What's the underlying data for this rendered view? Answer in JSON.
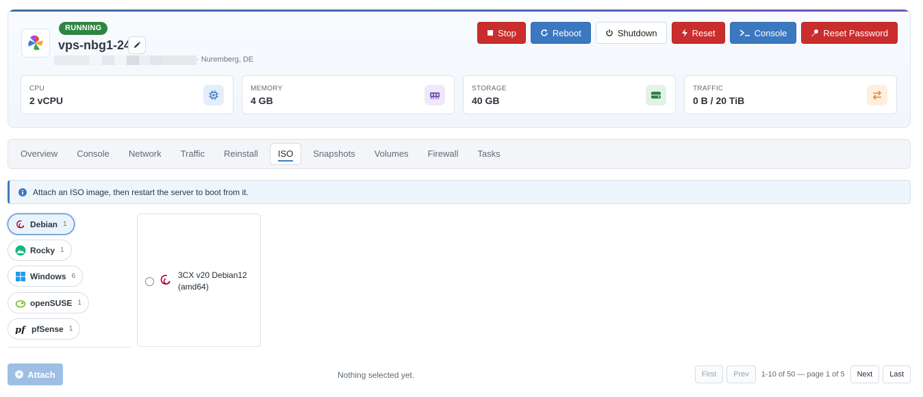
{
  "server": {
    "status": "RUNNING",
    "name": "vps-nbg1-24",
    "location": "· Nuremberg, DE",
    "status_color": "#2e8540"
  },
  "actions": [
    {
      "label": "Stop",
      "icon": "stop-icon",
      "color": "#c92d2d"
    },
    {
      "label": "Reboot",
      "icon": "reboot-icon",
      "color": "#3c78c0"
    },
    {
      "label": "Shutdown",
      "icon": "power-icon",
      "color": "#ffffff"
    },
    {
      "label": "Reset",
      "icon": "bolt-icon",
      "color": "#c92d2d"
    },
    {
      "label": "Console",
      "icon": "terminal-icon",
      "color": "#3c78c0"
    },
    {
      "label": "Reset Password",
      "icon": "key-icon",
      "color": "#c92d2d"
    }
  ],
  "stats": [
    {
      "label": "CPU",
      "value": "2 vCPU",
      "icon": "chip-icon"
    },
    {
      "label": "MEMORY",
      "value": "4 GB",
      "icon": "memory-icon"
    },
    {
      "label": "STORAGE",
      "value": "40 GB",
      "icon": "storage-icon"
    },
    {
      "label": "TRAFFIC",
      "value": "0 B / 20 TiB",
      "icon": "transfer-icon"
    }
  ],
  "tabs": [
    {
      "label": "Overview"
    },
    {
      "label": "Console"
    },
    {
      "label": "Network"
    },
    {
      "label": "Traffic"
    },
    {
      "label": "Reinstall"
    },
    {
      "label": "ISO",
      "active": true
    },
    {
      "label": "Snapshots"
    },
    {
      "label": "Volumes"
    },
    {
      "label": "Firewall"
    },
    {
      "label": "Tasks"
    }
  ],
  "info_banner": {
    "text": "Attach an ISO image, then restart the server to boot from it.",
    "icon": "info-icon"
  },
  "os_filters": [
    {
      "label": "Debian",
      "count": "1",
      "icon": "debian-icon",
      "active": true
    },
    {
      "label": "Rocky",
      "count": "1",
      "icon": "rocky-icon"
    },
    {
      "label": "Windows",
      "count": "6",
      "icon": "windows-icon"
    },
    {
      "label": "openSUSE",
      "count": "1",
      "icon": "opensuse-icon"
    },
    {
      "label": "pfSense",
      "count": "1",
      "icon": "pfsense-icon"
    }
  ],
  "iso_items": [
    {
      "name": "3CX v20 Debian12 (amd64)",
      "icon": "debian-icon",
      "selected": false
    }
  ],
  "footer": {
    "attach_label": "Attach",
    "selection_status": "Nothing selected yet.",
    "pagination": {
      "first": "First",
      "prev": "Prev",
      "info": "1-10 of 50 — page 1 of 5",
      "next": "Next",
      "last": "Last"
    }
  }
}
